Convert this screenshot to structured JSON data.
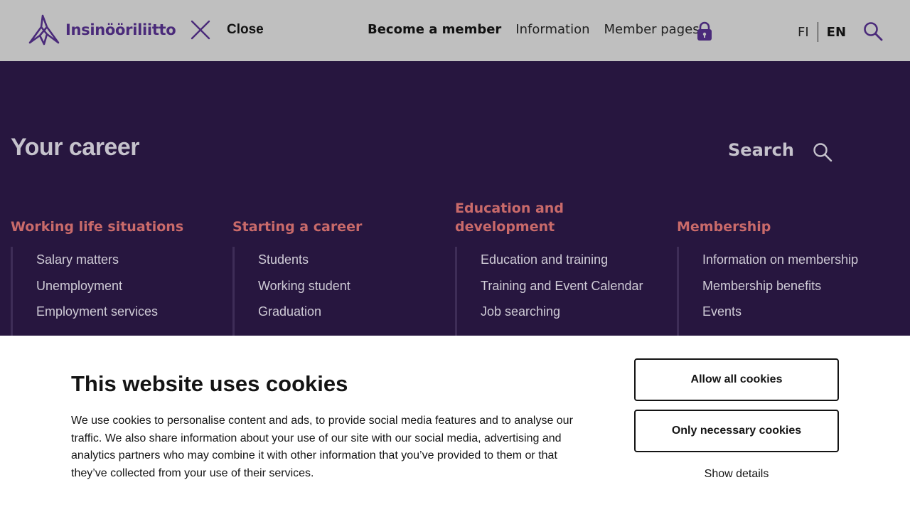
{
  "header": {
    "logo_text": "Insinööriliitto",
    "close_label": "Close",
    "nav": [
      {
        "label": "Become a member"
      },
      {
        "label": "Information"
      },
      {
        "label": "Member pages"
      }
    ],
    "languages": [
      "FI",
      "EN"
    ],
    "active_language": "EN",
    "icons": [
      "logo-icon",
      "close-icon",
      "lock-icon",
      "search-icon"
    ]
  },
  "menu": {
    "title": "Your career",
    "search_label": "Search",
    "columns": [
      {
        "title": "Working life situations",
        "items": [
          "Salary matters",
          "Unemployment",
          "Employment services"
        ]
      },
      {
        "title": "Starting a career",
        "items": [
          "Students",
          "Working student",
          "Graduation"
        ]
      },
      {
        "title": "Education and development",
        "items": [
          "Education and training",
          "Training and Event Calendar",
          "Job searching"
        ]
      },
      {
        "title": "Membership",
        "items": [
          "Information on membership",
          "Membership benefits",
          "Events"
        ]
      }
    ]
  },
  "cookie": {
    "title": "This website uses cookies",
    "text": "We use cookies to personalise content and ads, to provide social media features and to analyse our traffic. We also share information about your use of our site with our social media, advertising and analytics partners who may combine it with other information that you’ve provided to them or that they’ve collected from your use of their services.",
    "allow_all": "Allow all cookies",
    "only_necessary": "Only necessary cookies",
    "show_details": "Show details"
  },
  "colors": {
    "header_bg": "#bfbfbf",
    "panel_bg": "#27163f",
    "brand_purple": "#4a2a7a",
    "column_title": "#c96a6a",
    "menu_text": "#cfcbd6"
  }
}
